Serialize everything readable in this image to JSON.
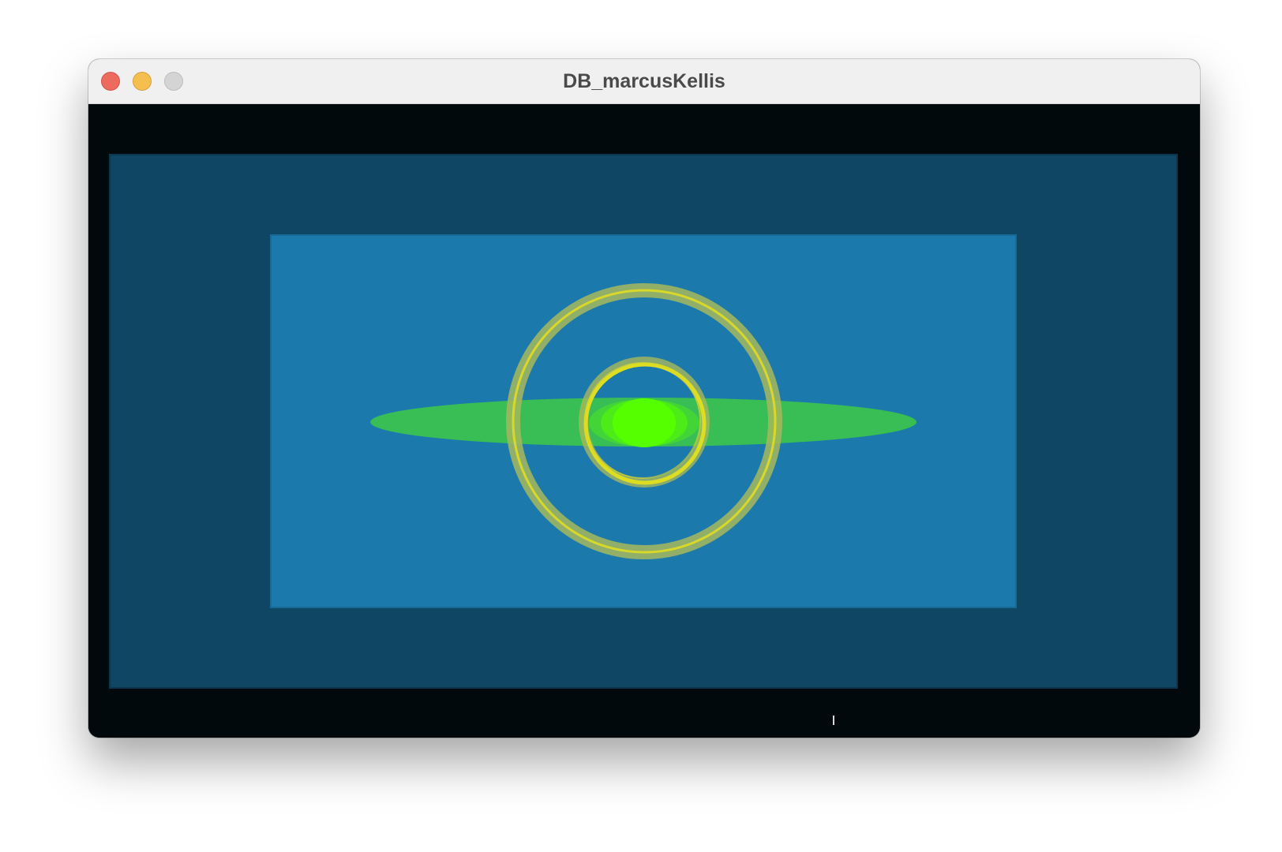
{
  "window": {
    "title": "DB_marcusKellis",
    "controls": {
      "close": "close-button",
      "minimize": "minimize-button",
      "zoom": "zoom-button"
    }
  },
  "scene": {
    "background": "#02090d",
    "outer_panel_color": "#0f4663",
    "inner_panel_color": "#1b7aab",
    "disc_color": "#39bd55",
    "core_color": "#55ff00",
    "outer_ring_color": "#a6b85c",
    "ring_line_color": "#d8d82a",
    "inner_ring_color": "#dddd22"
  }
}
